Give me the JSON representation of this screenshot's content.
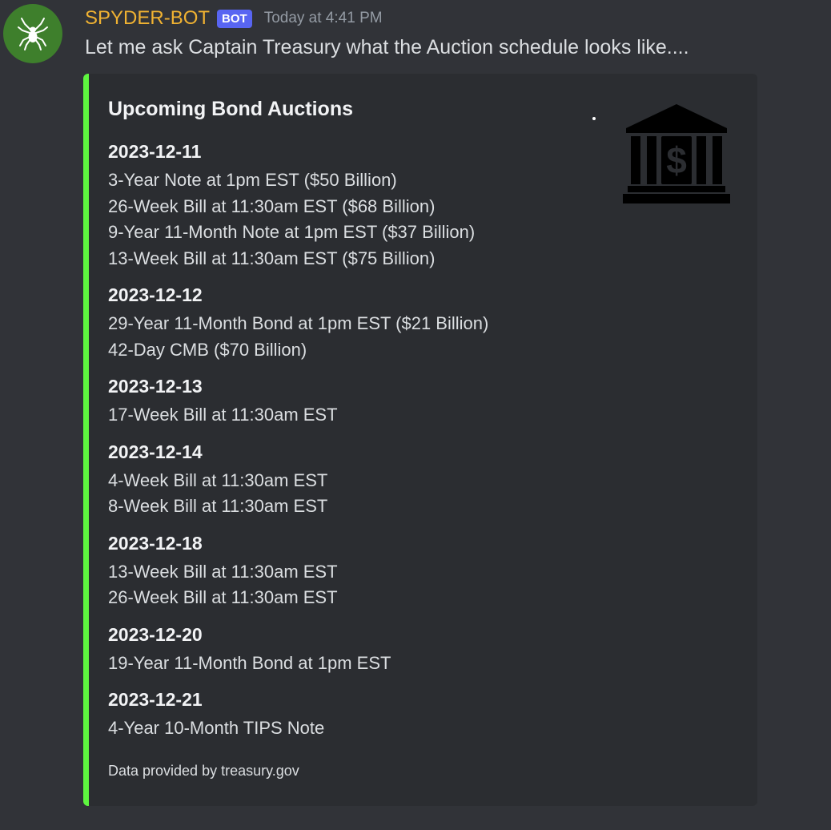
{
  "message": {
    "username": "SPYDER-BOT",
    "badge": "BOT",
    "timestamp": "Today at 4:41 PM",
    "content": "Let me ask Captain Treasury what the Auction schedule looks like....",
    "avatar_icon": "spider-icon",
    "username_color": "#f0b232"
  },
  "embed": {
    "accent_color": "#5ef53f",
    "title": "Upcoming Bond Auctions",
    "thumbnail_icon": "bank-dollar-icon",
    "footer": "Data provided by treasury.gov",
    "fields": [
      {
        "name": "2023-12-11",
        "lines": [
          "3-Year Note at 1pm EST ($50 Billion)",
          "26-Week Bill at 11:30am EST ($68 Billion)",
          "9-Year 11-Month Note at 1pm EST ($37 Billion)",
          "13-Week Bill at 11:30am EST ($75 Billion)"
        ]
      },
      {
        "name": "2023-12-12",
        "lines": [
          "29-Year 11-Month Bond at 1pm EST ($21 Billion)",
          "42-Day CMB ($70 Billion)"
        ]
      },
      {
        "name": "2023-12-13",
        "lines": [
          "17-Week Bill at 11:30am EST"
        ]
      },
      {
        "name": "2023-12-14",
        "lines": [
          "4-Week Bill at 11:30am EST",
          "8-Week Bill at 11:30am EST"
        ]
      },
      {
        "name": "2023-12-18",
        "lines": [
          "13-Week Bill at 11:30am EST",
          "26-Week Bill at 11:30am EST"
        ]
      },
      {
        "name": "2023-12-20",
        "lines": [
          "19-Year 11-Month Bond at 1pm EST"
        ]
      },
      {
        "name": "2023-12-21",
        "lines": [
          "4-Year 10-Month TIPS Note"
        ]
      }
    ]
  }
}
